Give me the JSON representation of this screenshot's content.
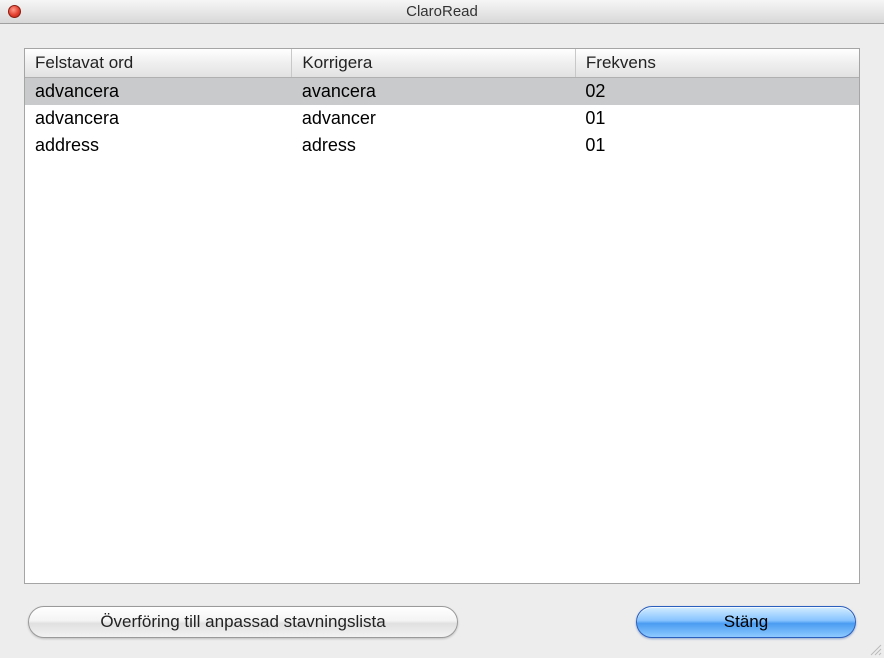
{
  "window": {
    "title": "ClaroRead"
  },
  "table": {
    "headers": {
      "misspelled": "Felstavat ord",
      "correct": "Korrigera",
      "frequency": "Frekvens"
    },
    "rows": [
      {
        "misspelled": "advancera",
        "correct": "avancera",
        "frequency": "02",
        "selected": true
      },
      {
        "misspelled": "advancera",
        "correct": "advancer",
        "frequency": "01",
        "selected": false
      },
      {
        "misspelled": "address",
        "correct": "adress",
        "frequency": "01",
        "selected": false
      }
    ]
  },
  "buttons": {
    "transfer": "Överföring till anpassad stavningslista",
    "close": "Stäng"
  }
}
